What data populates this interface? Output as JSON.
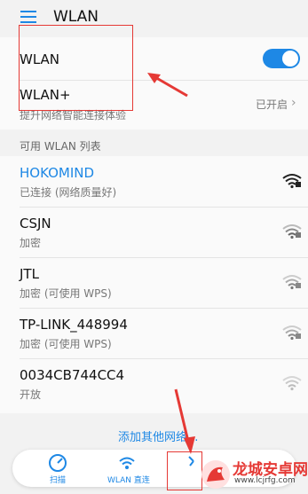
{
  "header": {
    "title": "WLAN"
  },
  "wlan_row": {
    "label": "WLAN",
    "enabled": true
  },
  "wlan_plus": {
    "label": "WLAN+",
    "subtitle": "提升网络智能连接体验",
    "status": "已开启"
  },
  "networks_section": {
    "title": "可用 WLAN 列表"
  },
  "networks": [
    {
      "name": "HOKOMIND",
      "status": "已连接 (网络质量好)",
      "connected": true,
      "icon": "wifi-full-icon"
    },
    {
      "name": "CSJN",
      "status": "加密",
      "connected": false,
      "icon": "wifi-lock-icon"
    },
    {
      "name": "JTL",
      "status": "加密 (可使用 WPS)",
      "connected": false,
      "icon": "wifi-lock-icon"
    },
    {
      "name": "TP-LINK_448994",
      "status": "加密 (可使用 WPS)",
      "connected": false,
      "icon": "wifi-lock-icon"
    },
    {
      "name": "0034CB744CC4",
      "status": "开放",
      "connected": false,
      "icon": "wifi-open-icon"
    }
  ],
  "add_network": {
    "label": "添加其他网络..."
  },
  "bottom_tabs": [
    {
      "label": "扫描",
      "icon": "scan-icon"
    },
    {
      "label": "WLAN 直连",
      "icon": "wifi-direct-icon"
    },
    {
      "label": "",
      "icon": "settings-icon"
    }
  ],
  "watermark": {
    "brand": "龙城安卓网",
    "url": "www.lcjrfg.com"
  },
  "colors": {
    "accent": "#1e88e5",
    "annotation": "#e53935"
  }
}
